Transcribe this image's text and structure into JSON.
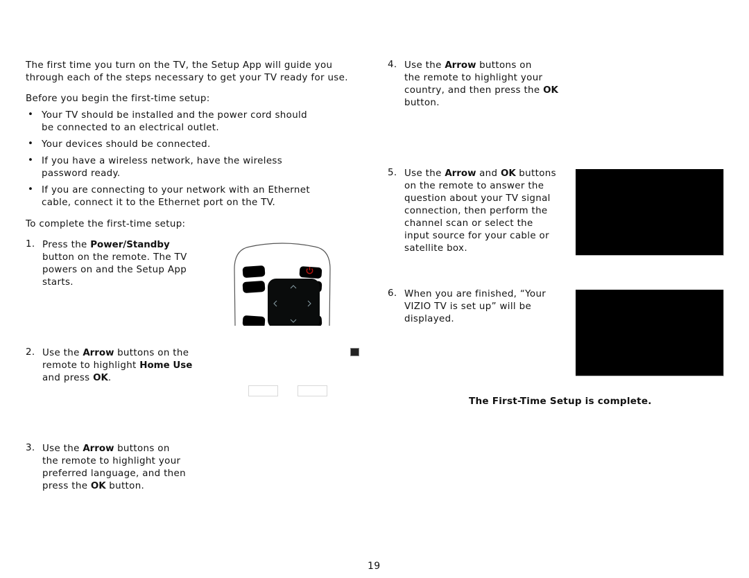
{
  "intro": {
    "lines": [
      "The first time you turn on the TV, the Setup App will guide you",
      "through each of the steps necessary to get your TV ready for use."
    ]
  },
  "before_heading": "Before you begin the first-time setup:",
  "bullet_glyph": "•",
  "bullets": [
    {
      "lines": [
        "Your TV should be installed and the power cord should",
        "be connected to an electrical outlet."
      ]
    },
    {
      "lines": [
        "Your devices should be connected."
      ]
    },
    {
      "lines": [
        "If you have a wireless network, have the wireless",
        "password ready."
      ]
    },
    {
      "lines": [
        "If you are connecting to your network with an Ethernet",
        "cable, connect it to the Ethernet port on the TV."
      ]
    }
  ],
  "complete_heading": "To complete the first-time setup:",
  "steps": [
    {
      "number": "1.",
      "lines": [
        [
          "Press the ",
          {
            "b": "Power/Standby"
          }
        ],
        [
          "button on the remote. The TV"
        ],
        [
          "powers on and the Setup App"
        ],
        [
          "starts."
        ]
      ]
    },
    {
      "number": "2.",
      "lines": [
        [
          "Use the ",
          {
            "b": "Arrow"
          },
          " buttons on the"
        ],
        [
          "remote to highlight ",
          {
            "b": "Home Use"
          }
        ],
        [
          "and press ",
          {
            "b": "OK"
          },
          "."
        ]
      ]
    },
    {
      "number": "3.",
      "lines": [
        [
          "Use the ",
          {
            "b": "Arrow"
          },
          " buttons on"
        ],
        [
          "the remote to highlight your"
        ],
        [
          "preferred language, and then"
        ],
        [
          "press the ",
          {
            "b": "OK"
          },
          " button."
        ]
      ]
    },
    {
      "number": "4.",
      "lines": [
        [
          "Use the ",
          {
            "b": "Arrow"
          },
          " buttons on"
        ],
        [
          "the remote to highlight your"
        ],
        [
          "country, and then press the ",
          {
            "b": "OK"
          }
        ],
        [
          "button."
        ]
      ]
    },
    {
      "number": "5.",
      "lines": [
        [
          "Use the ",
          {
            "b": "Arrow"
          },
          " and ",
          {
            "b": "OK"
          },
          " buttons"
        ],
        [
          "on the remote to answer the"
        ],
        [
          "question about your TV signal"
        ],
        [
          "connection, then perform the"
        ],
        [
          "channel scan or select the"
        ],
        [
          "input source for your cable or"
        ],
        [
          "satellite box."
        ]
      ]
    },
    {
      "number": "6.",
      "lines": [
        [
          "When you are finished, “Your"
        ],
        [
          "VIZIO TV is set up” will be"
        ],
        [
          "displayed."
        ]
      ]
    }
  ],
  "completion_message": "The First-Time Setup is complete.",
  "page_number": "19",
  "colors": {
    "power_icon": "#b0140e",
    "dpad_arrows": "#8aa0a8",
    "screen": "#000000"
  }
}
